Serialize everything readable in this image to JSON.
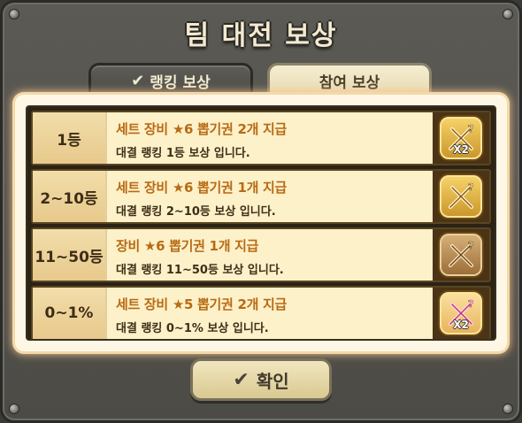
{
  "title": "팀 대전 보상",
  "tabs": [
    {
      "label": "랭킹 보상",
      "active": true
    },
    {
      "label": "참여 보상",
      "active": false
    }
  ],
  "rewards": [
    {
      "rank": "1등",
      "title": "세트 장비 ★6 뽑기권 2개 지급",
      "description": "대결 랭킹 1등 보상 입니다.",
      "badge": "X2",
      "icon": "gold-sword-coupon-icon"
    },
    {
      "rank": "2~10등",
      "title": "세트 장비 ★6 뽑기권 1개 지급",
      "description": "대결 랭킹 2~10등 보상 입니다.",
      "badge": "",
      "icon": "gold-sword-coupon-icon"
    },
    {
      "rank": "11~50등",
      "title": "장비 ★6 뽑기권 1개 지급",
      "description": "대결 랭킹 11~50등 보상 입니다.",
      "badge": "",
      "icon": "bronze-sword-coupon-icon"
    },
    {
      "rank": "0~1%",
      "title": "세트 장비 ★5 뽑기권 2개 지급",
      "description": "대결 랭킹 0~1% 보상 입니다.",
      "badge": "X2",
      "icon": "pink-sword-coupon-icon"
    }
  ],
  "confirm_label": "확인",
  "check_glyph": "✔"
}
